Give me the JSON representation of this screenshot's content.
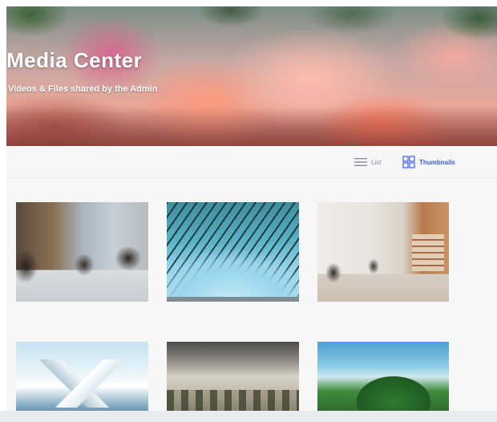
{
  "hero": {
    "title": "Media Center",
    "subtitle": "Videos & Files shared by the Admin"
  },
  "toolbar": {
    "list_label": "List",
    "thumbnails_label": "Thumbnails",
    "active_view": "Thumbnails",
    "colors": {
      "active": "#3d5bd9",
      "inactive": "#8a8d95"
    }
  },
  "gallery": {
    "items": [
      {
        "subject": "office-meeting-photo"
      },
      {
        "subject": "lattice-dome-photo"
      },
      {
        "subject": "coworking-space-photo"
      },
      {
        "subject": "snowy-mountains-photo"
      },
      {
        "subject": "misty-karst-photo"
      },
      {
        "subject": "green-hills-photo"
      }
    ]
  },
  "icons": {
    "list": "list-icon",
    "thumbnails": "grid-icon"
  }
}
